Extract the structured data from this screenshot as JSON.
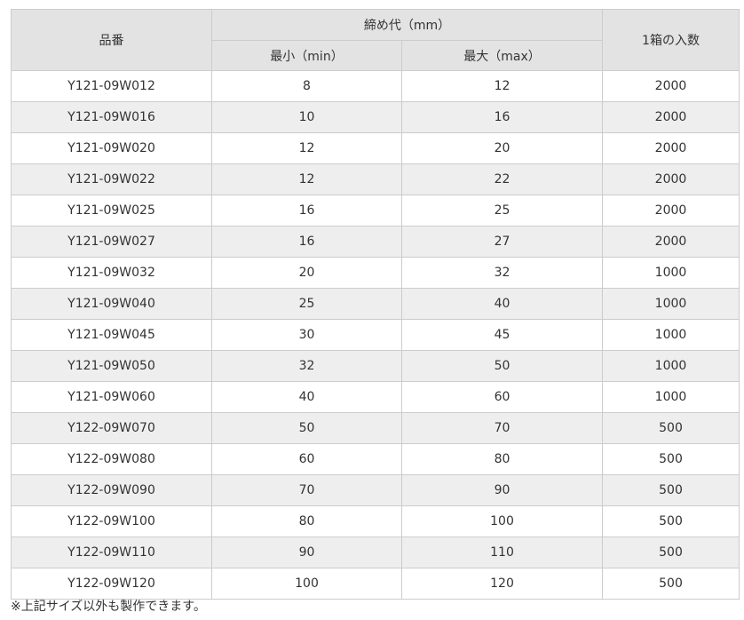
{
  "table": {
    "headers": {
      "part_no": "品番",
      "tightening_range": "締め代（mm）",
      "min": "最小（min）",
      "max": "最大（max）",
      "qty_per_box": "1箱の入数"
    },
    "rows": [
      {
        "part": "Y121-09W012",
        "min": "8",
        "max": "12",
        "qty": "2000"
      },
      {
        "part": "Y121-09W016",
        "min": "10",
        "max": "16",
        "qty": "2000"
      },
      {
        "part": "Y121-09W020",
        "min": "12",
        "max": "20",
        "qty": "2000"
      },
      {
        "part": "Y121-09W022",
        "min": "12",
        "max": "22",
        "qty": "2000"
      },
      {
        "part": "Y121-09W025",
        "min": "16",
        "max": "25",
        "qty": "2000"
      },
      {
        "part": "Y121-09W027",
        "min": "16",
        "max": "27",
        "qty": "2000"
      },
      {
        "part": "Y121-09W032",
        "min": "20",
        "max": "32",
        "qty": "1000"
      },
      {
        "part": "Y121-09W040",
        "min": "25",
        "max": "40",
        "qty": "1000"
      },
      {
        "part": "Y121-09W045",
        "min": "30",
        "max": "45",
        "qty": "1000"
      },
      {
        "part": "Y121-09W050",
        "min": "32",
        "max": "50",
        "qty": "1000"
      },
      {
        "part": "Y121-09W060",
        "min": "40",
        "max": "60",
        "qty": "1000"
      },
      {
        "part": "Y122-09W070",
        "min": "50",
        "max": "70",
        "qty": "500"
      },
      {
        "part": "Y122-09W080",
        "min": "60",
        "max": "80",
        "qty": "500"
      },
      {
        "part": "Y122-09W090",
        "min": "70",
        "max": "90",
        "qty": "500"
      },
      {
        "part": "Y122-09W100",
        "min": "80",
        "max": "100",
        "qty": "500"
      },
      {
        "part": "Y122-09W110",
        "min": "90",
        "max": "110",
        "qty": "500"
      },
      {
        "part": "Y122-09W120",
        "min": "100",
        "max": "120",
        "qty": "500"
      }
    ]
  },
  "note": "※上記サイズ以外も製作できます。",
  "colors": {
    "header_bg": "#e3e3e3",
    "stripe_bg": "#eeeeee",
    "border": "#cccccc",
    "text": "#333333"
  }
}
